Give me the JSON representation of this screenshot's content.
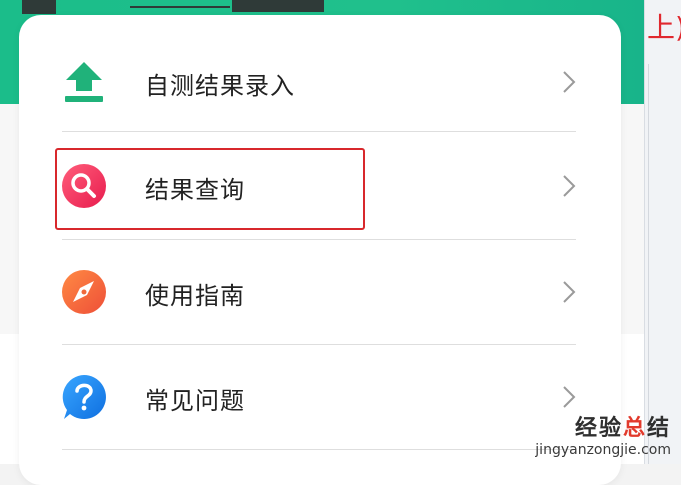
{
  "menu": {
    "items": [
      {
        "label": "自测结果录入",
        "icon": "upload-arrow-icon",
        "icon_color": "#20b27a"
      },
      {
        "label": "结果查询",
        "icon": "search-icon",
        "icon_color": "#f0305a"
      },
      {
        "label": "使用指南",
        "icon": "compass-icon",
        "icon_color": "#f0663a"
      },
      {
        "label": "常见问题",
        "icon": "question-icon",
        "icon_color": "#1a88ef"
      }
    ],
    "highlighted_item": "结果查询",
    "highlight_color": "#d8282c"
  },
  "side_panel": {
    "partial_text": "上)"
  },
  "watermark": {
    "cn_prefix": "经验",
    "cn_accent": "总",
    "cn_suffix": "结",
    "url": "jingyanzongjie.com"
  },
  "colors": {
    "banner": "#1fbe8c",
    "chevron": "#9a9a9a",
    "divider": "#dedede"
  }
}
